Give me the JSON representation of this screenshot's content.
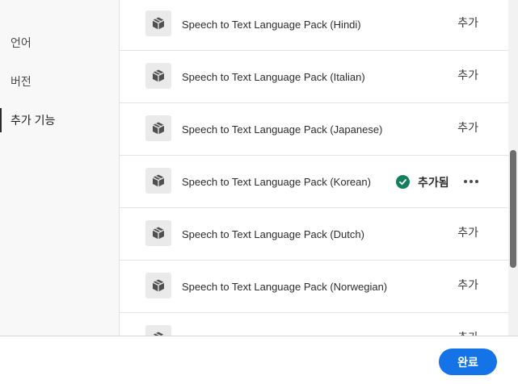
{
  "sidebar": {
    "items": [
      {
        "label": "언어"
      },
      {
        "label": "버전"
      },
      {
        "label": "추가 기능",
        "active": true
      }
    ]
  },
  "packages": [
    {
      "name": "Speech to Text Language Pack (Hindi)",
      "status": "add",
      "action_label": "추가"
    },
    {
      "name": "Speech to Text Language Pack (Italian)",
      "status": "add",
      "action_label": "추가"
    },
    {
      "name": "Speech to Text Language Pack (Japanese)",
      "status": "add",
      "action_label": "추가"
    },
    {
      "name": "Speech to Text Language Pack (Korean)",
      "status": "added",
      "action_label": "추가됨",
      "status_icon": "checkmark-circle-icon",
      "menu_icon": "more-options-icon"
    },
    {
      "name": "Speech to Text Language Pack (Dutch)",
      "status": "add",
      "action_label": "추가"
    },
    {
      "name": "Speech to Text Language Pack (Norwegian)",
      "status": "add",
      "action_label": "추가"
    },
    {
      "name": "",
      "status": "add",
      "action_label": "추가"
    }
  ],
  "package_icon": "package-box-icon",
  "footer": {
    "done_label": "완료"
  },
  "colors": {
    "accent": "#1473e6",
    "success": "#12805c",
    "panel_bg": "#f8f8f8",
    "row_bg": "#ffffff"
  }
}
